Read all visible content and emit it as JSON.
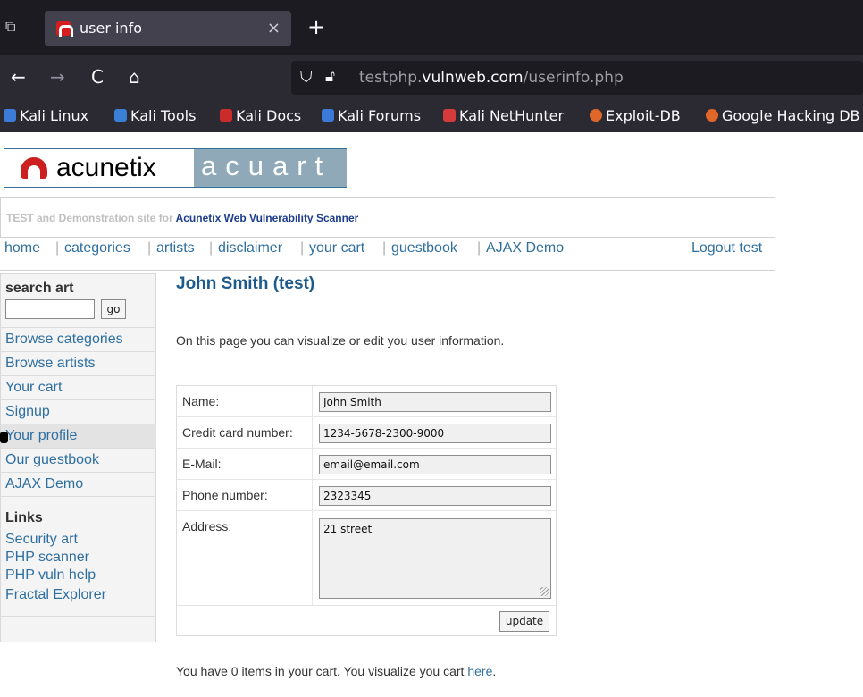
{
  "browser": {
    "tab_title": "user info",
    "tab_close": "×",
    "new_tab": "+",
    "back": "←",
    "forward": "→",
    "reload": "C",
    "home": "⌂",
    "url_prefix": "testphp.",
    "url_host": "vulnweb.com",
    "url_path": "/userinfo.php",
    "bookmarks": [
      {
        "label": "Kali Linux",
        "color": "#3d7bd9"
      },
      {
        "label": "Kali Tools",
        "color": "#3a7fd6"
      },
      {
        "label": "Kali Docs",
        "color": "#cc2b2b"
      },
      {
        "label": "Kali Forums",
        "color": "#3b7ad8"
      },
      {
        "label": "Kali NetHunter",
        "color": "#d63a3a"
      },
      {
        "label": "Exploit-DB",
        "color": "#e0662a"
      },
      {
        "label": "Google Hacking DB",
        "color": "#e0662a"
      }
    ]
  },
  "site": {
    "logo_word": "acunetix",
    "logo_art": "acuart",
    "strip_grey": "TEST and Demonstration site for ",
    "strip_blue": "Acunetix Web Vulnerability Scanner",
    "nav": [
      "home",
      "categories",
      "artists",
      "disclaimer",
      "your cart",
      "guestbook",
      "AJAX Demo"
    ],
    "logout": "Logout test"
  },
  "sidebar": {
    "search_title": "search art",
    "search_value": "",
    "go_label": "go",
    "links": [
      "Browse categories",
      "Browse artists",
      "Your cart",
      "Signup",
      "Your profile",
      "Our guestbook",
      "AJAX Demo"
    ],
    "links_title": "Links",
    "external": [
      "Security art",
      "PHP scanner",
      "PHP vuln help",
      "Fractal Explorer"
    ]
  },
  "main": {
    "title": "John Smith (test)",
    "intro": "On this page you can visualize or edit you user information.",
    "fields": [
      {
        "label": "Name:",
        "value": "John Smith"
      },
      {
        "label": "Credit card number:",
        "value": "1234-5678-2300-9000"
      },
      {
        "label": "E-Mail:",
        "value": "email@email.com"
      },
      {
        "label": "Phone number:",
        "value": "2323345"
      }
    ],
    "address_label": "Address:",
    "address_value": "21 street",
    "update_label": "update",
    "cart_text": "You have 0 items in your cart. You visualize you cart ",
    "cart_link": "here",
    "cart_end": "."
  }
}
